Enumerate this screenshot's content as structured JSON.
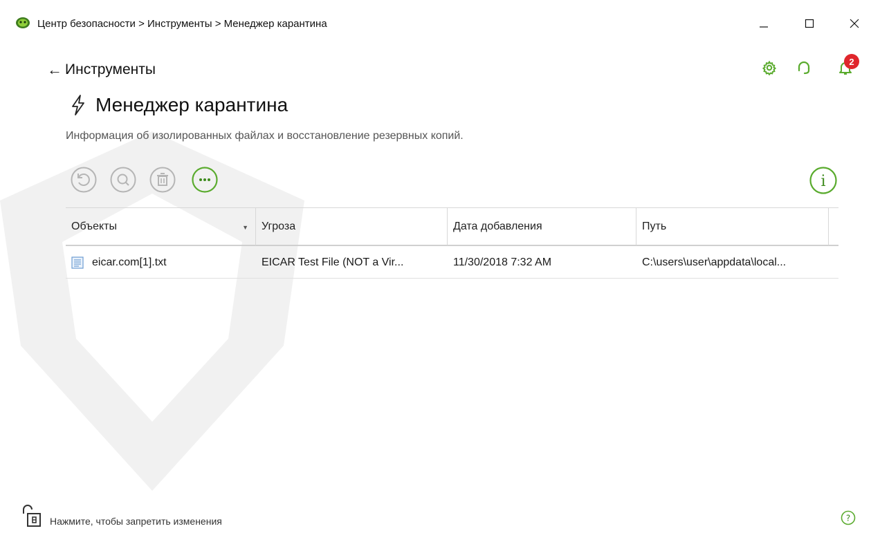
{
  "window": {
    "title": "Центр безопасности > Инструменты > Менеджер карантина",
    "controls": {
      "minimize": "minimize-icon",
      "maximize": "maximize-icon",
      "close": "close-icon"
    }
  },
  "header": {
    "back_label": "Инструменты",
    "notifications_count": "2",
    "icons": [
      "gear-icon",
      "headset-icon",
      "bell-icon"
    ]
  },
  "page": {
    "title": "Менеджер карантина",
    "description": "Информация об изолированных файлах и восстановление резервных копий."
  },
  "toolbar": {
    "buttons": [
      "restore-icon",
      "search-icon",
      "trash-icon",
      "more-icon"
    ],
    "info": "info-icon"
  },
  "table": {
    "columns": [
      "Объекты",
      "Угроза",
      "Дата добавления",
      "Путь"
    ],
    "rows": [
      {
        "object": "eicar.com[1].txt",
        "threat": "EICAR Test File (NOT a Vir...",
        "date": "11/30/2018 7:32 AM",
        "path": "C:\\users\\user\\appdata\\local..."
      }
    ]
  },
  "footer": {
    "lock_label": "Нажмите, чтобы запретить изменения",
    "help": "help-icon"
  },
  "colors": {
    "accent": "#5aab2e",
    "disabled": "#b5b5b5",
    "badge": "#e0262c"
  }
}
